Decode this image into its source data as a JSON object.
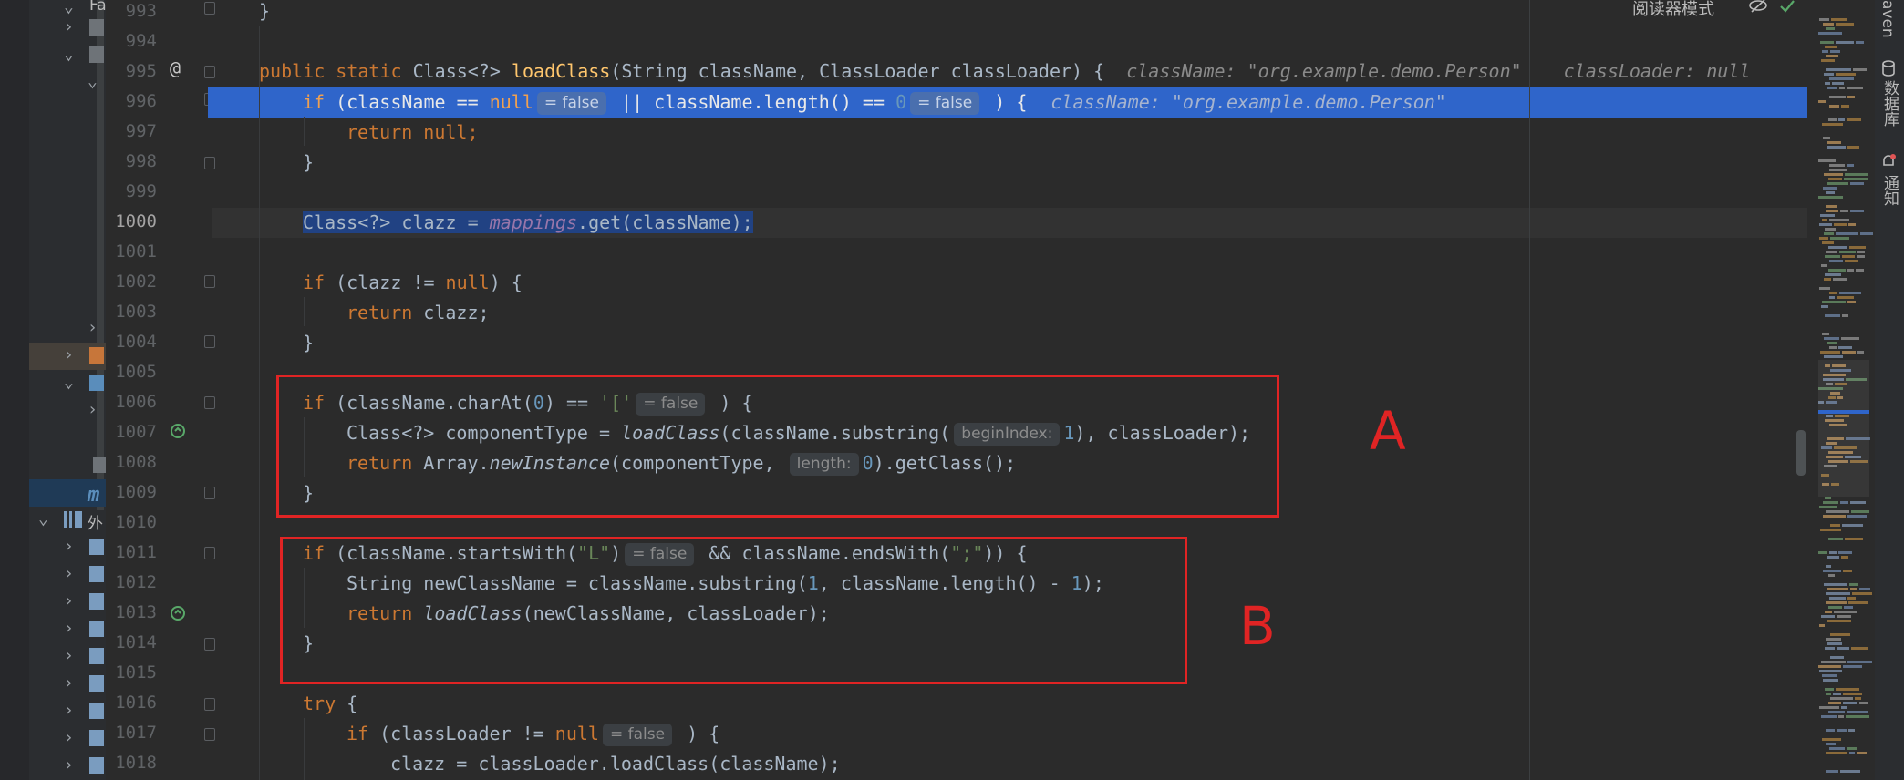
{
  "top_bar": {
    "reader_mode": "阅读器模式"
  },
  "right_tools": {
    "maven": "aven",
    "database": "数据库",
    "notifications": "通知"
  },
  "sidebar": {
    "visible_text_1": "Fa",
    "visible_text_2": "外"
  },
  "lines": [
    {
      "num": "993"
    },
    {
      "num": "994"
    },
    {
      "num": "995"
    },
    {
      "num": "996"
    },
    {
      "num": "997"
    },
    {
      "num": "998"
    },
    {
      "num": "999"
    },
    {
      "num": "1000"
    },
    {
      "num": "1001"
    },
    {
      "num": "1002"
    },
    {
      "num": "1003"
    },
    {
      "num": "1004"
    },
    {
      "num": "1005"
    },
    {
      "num": "1006"
    },
    {
      "num": "1007"
    },
    {
      "num": "1008"
    },
    {
      "num": "1009"
    },
    {
      "num": "1010"
    },
    {
      "num": "1011"
    },
    {
      "num": "1012"
    },
    {
      "num": "1013"
    },
    {
      "num": "1014"
    },
    {
      "num": "1015"
    },
    {
      "num": "1016"
    },
    {
      "num": "1017"
    },
    {
      "num": "1018"
    }
  ],
  "code": {
    "l993_brace": "}",
    "l995_public": "public static ",
    "l995_class": "Class<?> ",
    "l995_fn": "loadClass",
    "l995_args": "(String className, ClassLoader classLoader) {",
    "l995_hint1": "className: \"org.example.demo.Person\"",
    "l995_hint2": "classLoader: null",
    "l996_if": "if",
    "l996_a": " (className == ",
    "l996_null": "null",
    "l996_b": " || className.length() == ",
    "l996_zero": "0",
    "l996_c": " ) {",
    "l996_hint": "className: \"org.example.demo.Person\"",
    "hint_false": "= false",
    "l997_return": "return ",
    "l997_null": "null",
    "l997_semi": ";",
    "close_brace": "}",
    "l1000_a": "Class<?> clazz = ",
    "l1000_field": "mappings",
    "l1000_b": ".get(className);",
    "l1002_if": "if",
    "l1002_a": " (clazz != ",
    "l1002_null": "null",
    "l1002_b": ") {",
    "l1003_return": "return ",
    "l1003_a": "clazz;",
    "l1006_if": "if",
    "l1006_a": " (className.charAt(",
    "l1006_zero": "0",
    "l1006_b": ") == ",
    "l1006_str": "'['",
    "l1006_c": " ) {",
    "l1007_a": "Class<?> componentType = ",
    "l1007_fn": "loadClass",
    "l1007_b": "(className.substring(",
    "l1007_hint": "beginIndex:",
    "l1007_one": "1",
    "l1007_c": "), classLoader);",
    "l1008_return": "return ",
    "l1008_a": "Array.",
    "l1008_fn": "newInstance",
    "l1008_b": "(componentType, ",
    "l1008_hint": "length:",
    "l1008_zero": "0",
    "l1008_c": ").getClass();",
    "l1011_if": "if",
    "l1011_a": " (className.startsWith(",
    "l1011_str": "\"L\"",
    "l1011_b": ")",
    "l1011_c": " && className.endsWith(",
    "l1011_str2": "\";\"",
    "l1011_d": ")) {",
    "l1012_a": "String newClassName = className.substring(",
    "l1012_one": "1",
    "l1012_b": ", className.length() - ",
    "l1012_one2": "1",
    "l1012_c": ");",
    "l1013_return": "return ",
    "l1013_fn": "loadClass",
    "l1013_a": "(newClassName, classLoader);",
    "l1016_try": "try",
    "l1016_a": " {",
    "l1017_if": "if",
    "l1017_a": " (classLoader != ",
    "l1017_null": "null",
    "l1017_b": " ) {",
    "l1018_a": "clazz = classLoader.loadClass(className);"
  },
  "annotations": {
    "box_a": "A",
    "box_b": "B"
  },
  "colors": {
    "selection": "#2f65ca",
    "annotation_red": "#e02424",
    "keyword": "#cc7832",
    "function": "#ffc66d"
  }
}
